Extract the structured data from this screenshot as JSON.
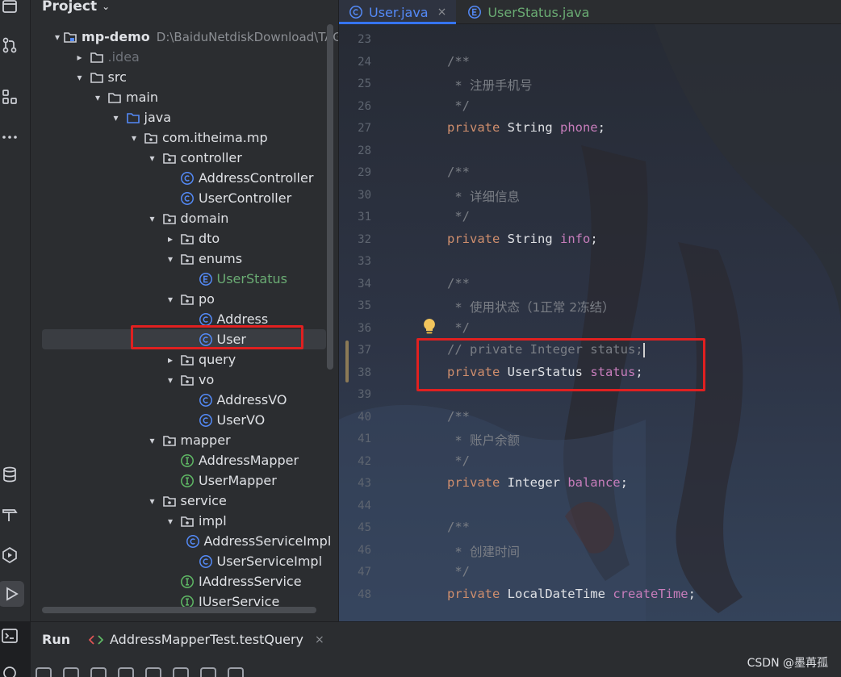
{
  "project_panel": {
    "title": "Project",
    "tree": [
      {
        "label": "mp-demo",
        "path": "D:\\BaiduNetdiskDownload\\TAG",
        "icon": "module-folder-icon",
        "toggle": "▾",
        "depth": 0,
        "style": "bold"
      },
      {
        "label": ".idea",
        "icon": "folder-icon",
        "toggle": "▸",
        "depth": 1,
        "style": "dim"
      },
      {
        "label": "src",
        "icon": "folder-icon",
        "toggle": "▾",
        "depth": 1
      },
      {
        "label": "main",
        "icon": "folder-icon",
        "toggle": "▾",
        "depth": 2
      },
      {
        "label": "java",
        "icon": "source-folder-icon",
        "toggle": "▾",
        "depth": 3
      },
      {
        "label": "com.itheima.mp",
        "icon": "package-icon",
        "toggle": "▾",
        "depth": 4
      },
      {
        "label": "controller",
        "icon": "package-icon",
        "toggle": "▾",
        "depth": 5
      },
      {
        "label": "AddressController",
        "icon": "class-icon",
        "toggle": "",
        "depth": 6
      },
      {
        "label": "UserController",
        "icon": "class-icon",
        "toggle": "",
        "depth": 6
      },
      {
        "label": "domain",
        "icon": "package-icon",
        "toggle": "▾",
        "depth": 5
      },
      {
        "label": "dto",
        "icon": "package-icon",
        "toggle": "▸",
        "depth": 6
      },
      {
        "label": "enums",
        "icon": "package-icon",
        "toggle": "▾",
        "depth": 6
      },
      {
        "label": "UserStatus",
        "icon": "enum-icon",
        "toggle": "",
        "depth": 7,
        "style": "green"
      },
      {
        "label": "po",
        "icon": "package-icon",
        "toggle": "▾",
        "depth": 6
      },
      {
        "label": "Address",
        "icon": "class-icon",
        "toggle": "",
        "depth": 7
      },
      {
        "label": "User",
        "icon": "class-icon",
        "toggle": "",
        "depth": 7,
        "selected": true
      },
      {
        "label": "query",
        "icon": "package-icon",
        "toggle": "▸",
        "depth": 6
      },
      {
        "label": "vo",
        "icon": "package-icon",
        "toggle": "▾",
        "depth": 6
      },
      {
        "label": "AddressVO",
        "icon": "class-icon",
        "toggle": "",
        "depth": 7
      },
      {
        "label": "UserVO",
        "icon": "class-icon",
        "toggle": "",
        "depth": 7
      },
      {
        "label": "mapper",
        "icon": "package-icon",
        "toggle": "▾",
        "depth": 5
      },
      {
        "label": "AddressMapper",
        "icon": "interface-icon",
        "toggle": "",
        "depth": 6
      },
      {
        "label": "UserMapper",
        "icon": "interface-icon",
        "toggle": "",
        "depth": 6
      },
      {
        "label": "service",
        "icon": "package-icon",
        "toggle": "▾",
        "depth": 5
      },
      {
        "label": "impl",
        "icon": "package-icon",
        "toggle": "▾",
        "depth": 6
      },
      {
        "label": "AddressServiceImpl",
        "icon": "class-icon",
        "toggle": "",
        "depth": 7
      },
      {
        "label": "UserServiceImpl",
        "icon": "class-icon",
        "toggle": "",
        "depth": 7
      },
      {
        "label": "IAddressService",
        "icon": "interface-icon",
        "toggle": "",
        "depth": 6
      },
      {
        "label": "IUserService",
        "icon": "interface-icon",
        "toggle": "",
        "depth": 6
      }
    ]
  },
  "editor": {
    "tabs": [
      {
        "label": "User.java",
        "icon": "class-icon",
        "active": true,
        "close": "×"
      },
      {
        "label": "UserStatus.java",
        "icon": "enum-icon",
        "active": false
      }
    ],
    "lines": [
      {
        "n": "23",
        "tokens": []
      },
      {
        "n": "24",
        "tokens": [
          [
            "cmt",
            "/**"
          ]
        ]
      },
      {
        "n": "25",
        "tokens": [
          [
            "cmt",
            " * "
          ],
          [
            "cmt-cn",
            "注册手机号"
          ]
        ]
      },
      {
        "n": "26",
        "tokens": [
          [
            "cmt",
            " */"
          ]
        ]
      },
      {
        "n": "27",
        "tokens": [
          [
            "kw",
            "private "
          ],
          [
            "ty",
            "String "
          ],
          [
            "fld",
            "phone"
          ],
          [
            "pun",
            ";"
          ]
        ]
      },
      {
        "n": "28",
        "tokens": []
      },
      {
        "n": "29",
        "tokens": [
          [
            "cmt",
            "/**"
          ]
        ]
      },
      {
        "n": "30",
        "tokens": [
          [
            "cmt",
            " * "
          ],
          [
            "cmt-cn",
            "详细信息"
          ]
        ]
      },
      {
        "n": "31",
        "tokens": [
          [
            "cmt",
            " */"
          ]
        ]
      },
      {
        "n": "32",
        "tokens": [
          [
            "kw",
            "private "
          ],
          [
            "ty",
            "String "
          ],
          [
            "fld",
            "info"
          ],
          [
            "pun",
            ";"
          ]
        ]
      },
      {
        "n": "33",
        "tokens": []
      },
      {
        "n": "34",
        "tokens": [
          [
            "cmt",
            "/**"
          ]
        ]
      },
      {
        "n": "35",
        "tokens": [
          [
            "cmt",
            " * "
          ],
          [
            "cmt-cn",
            "使用状态（1正常 2冻结）"
          ]
        ]
      },
      {
        "n": "36",
        "tokens": [
          [
            "cmt",
            " */"
          ]
        ]
      },
      {
        "n": "37",
        "tokens": [
          [
            "cmt",
            "// private Integer status;"
          ]
        ],
        "caret": true
      },
      {
        "n": "38",
        "tokens": [
          [
            "kw",
            "private "
          ],
          [
            "ty",
            "UserStatus "
          ],
          [
            "fld",
            "status"
          ],
          [
            "pun",
            ";"
          ]
        ]
      },
      {
        "n": "39",
        "tokens": []
      },
      {
        "n": "40",
        "tokens": [
          [
            "cmt",
            "/**"
          ]
        ]
      },
      {
        "n": "41",
        "tokens": [
          [
            "cmt",
            " * "
          ],
          [
            "cmt-cn",
            "账户余额"
          ]
        ]
      },
      {
        "n": "42",
        "tokens": [
          [
            "cmt",
            " */"
          ]
        ]
      },
      {
        "n": "43",
        "tokens": [
          [
            "kw",
            "private "
          ],
          [
            "ty",
            "Integer "
          ],
          [
            "fld",
            "balance"
          ],
          [
            "pun",
            ";"
          ]
        ]
      },
      {
        "n": "44",
        "tokens": []
      },
      {
        "n": "45",
        "tokens": [
          [
            "cmt",
            "/**"
          ]
        ]
      },
      {
        "n": "46",
        "tokens": [
          [
            "cmt",
            " * "
          ],
          [
            "cmt-cn",
            "创建时间"
          ]
        ]
      },
      {
        "n": "47",
        "tokens": [
          [
            "cmt",
            " */"
          ]
        ]
      },
      {
        "n": "48",
        "tokens": [
          [
            "kw",
            "private "
          ],
          [
            "ty",
            "LocalDateTime "
          ],
          [
            "fld",
            "createTime"
          ],
          [
            "pun",
            ";"
          ]
        ]
      }
    ]
  },
  "bottom": {
    "run_label": "Run",
    "run_config": "AddressMapperTest.testQuery",
    "close": "×"
  },
  "watermark": "CSDN @墨苒孤",
  "colors": {
    "accent": "#3574f0",
    "keyword": "#cf8e6d",
    "field": "#c77dbb",
    "comment": "#7a7e85",
    "enum_green": "#6aab73",
    "highlight_box": "#e02020"
  }
}
